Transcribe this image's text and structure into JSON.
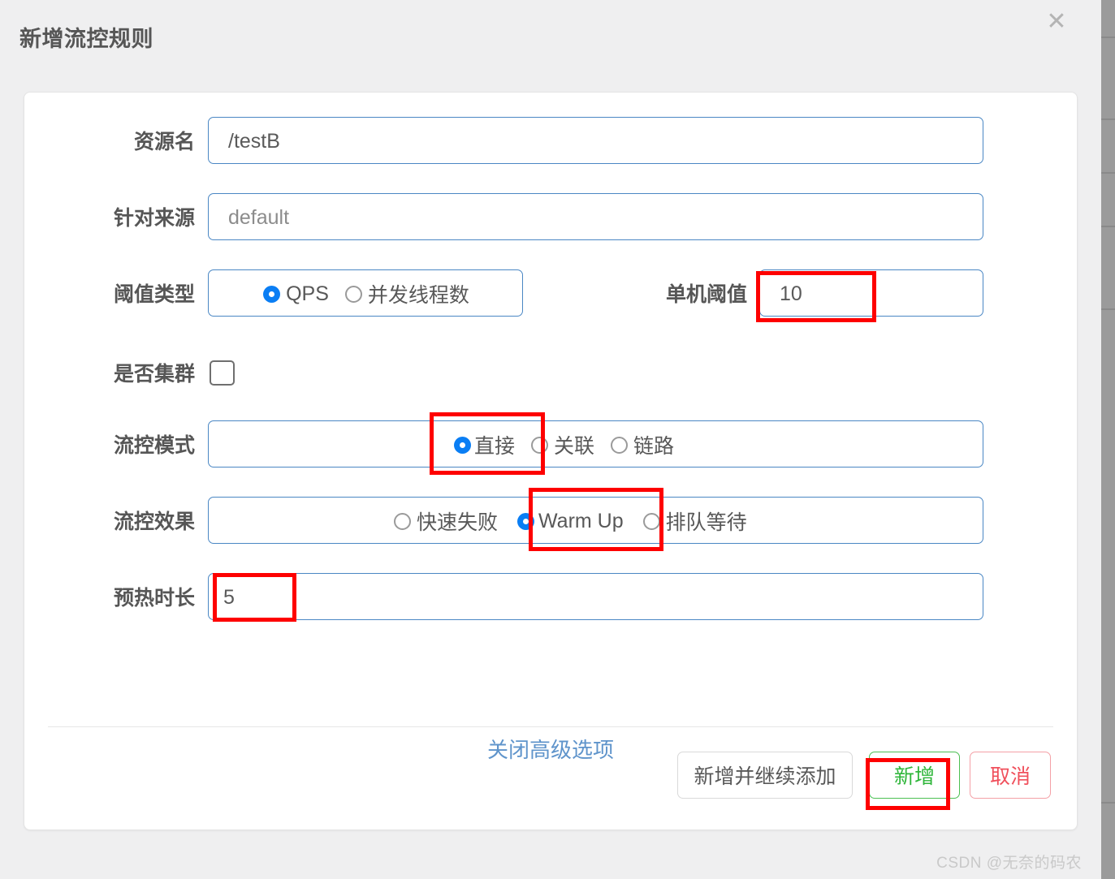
{
  "dialog": {
    "title": "新增流控规则",
    "close_icon": "close-icon"
  },
  "form": {
    "resource": {
      "label": "资源名",
      "value": "/testB"
    },
    "origin": {
      "label": "针对来源",
      "placeholder": "default"
    },
    "threshold_type": {
      "label": "阈值类型",
      "options": [
        {
          "label": "QPS",
          "selected": true
        },
        {
          "label": "并发线程数",
          "selected": false
        }
      ]
    },
    "single_threshold": {
      "label": "单机阈值",
      "value": "10"
    },
    "is_cluster": {
      "label": "是否集群",
      "checked": false
    },
    "flow_mode": {
      "label": "流控模式",
      "options": [
        {
          "label": "直接",
          "selected": true
        },
        {
          "label": "关联",
          "selected": false
        },
        {
          "label": "链路",
          "selected": false
        }
      ]
    },
    "flow_effect": {
      "label": "流控效果",
      "options": [
        {
          "label": "快速失败",
          "selected": false
        },
        {
          "label": "Warm Up",
          "selected": true
        },
        {
          "label": "排队等待",
          "selected": false
        }
      ]
    },
    "warmup_duration": {
      "label": "预热时长",
      "value": "5"
    },
    "advanced_link": "关闭高级选项"
  },
  "footer": {
    "add_continue_label": "新增并继续添加",
    "add_label": "新增",
    "cancel_label": "取消"
  },
  "colors": {
    "annotation": "#fe0000",
    "input_border": "#4a87c4",
    "radio_selected": "#0a7ef4",
    "link": "#5f94cb",
    "primary_button": "#2fb63a",
    "danger_button": "#f0505c"
  },
  "watermark": "CSDN @无奈的码农"
}
